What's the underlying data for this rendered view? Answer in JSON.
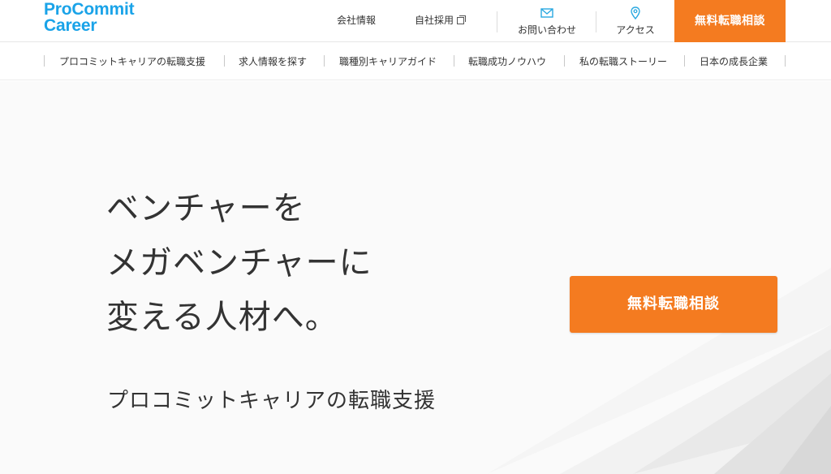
{
  "header": {
    "logo_line1": "ProCommit",
    "logo_line2": "Career",
    "links": {
      "company": "会社情報",
      "recruit": "自社採用",
      "contact": "お問い合わせ",
      "access": "アクセス"
    },
    "cta_label": "無料転職相談"
  },
  "subnav": {
    "items": [
      "プロコミットキャリアの転職支援",
      "求人情報を探す",
      "職種別キャリアガイド",
      "転職成功ノウハウ",
      "私の転職ストーリー",
      "日本の成長企業"
    ]
  },
  "hero": {
    "headline_lines": [
      "ベンチャーを",
      "メガベンチャーに",
      "変える人材へ。"
    ],
    "subline": "プロコミットキャリアの転職支援",
    "cta_label": "無料転職相談"
  },
  "colors": {
    "brand_blue": "#1aa3e8",
    "accent_orange": "#f47b20",
    "icon_blue": "#29a8e0"
  },
  "icons": {
    "recruit": "external-link-icon",
    "contact": "mail-icon",
    "access": "map-pin-icon"
  }
}
